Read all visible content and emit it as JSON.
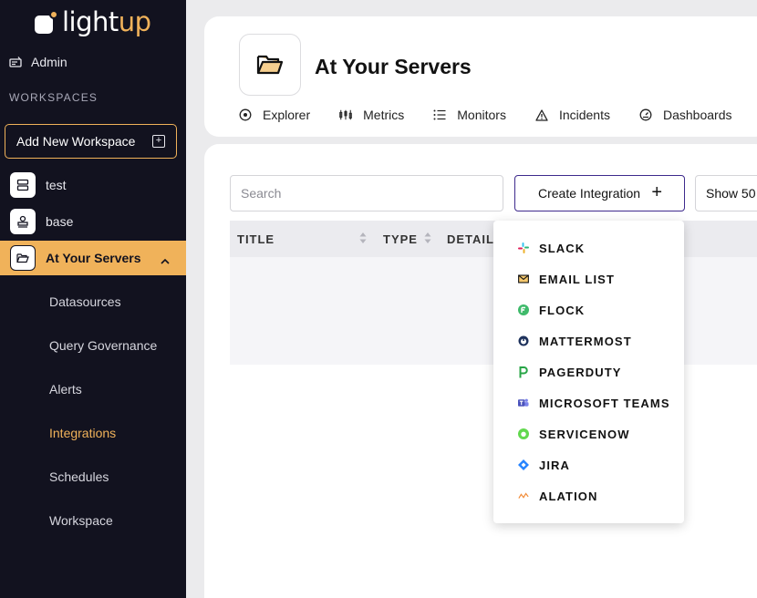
{
  "brand": {
    "part1": "light",
    "part2": "up"
  },
  "sidebar": {
    "admin_label": "Admin",
    "workspaces_label": "WORKSPACES",
    "add_workspace_label": "Add New Workspace",
    "workspaces": [
      {
        "label": "test"
      },
      {
        "label": "base"
      },
      {
        "label": "At Your Servers"
      }
    ],
    "sub_items": [
      {
        "label": "Datasources"
      },
      {
        "label": "Query Governance"
      },
      {
        "label": "Alerts"
      },
      {
        "label": "Integrations"
      },
      {
        "label": "Schedules"
      },
      {
        "label": "Workspace"
      }
    ]
  },
  "header": {
    "title": "At Your Servers",
    "tabs": [
      {
        "label": "Explorer",
        "icon": "explorer-icon"
      },
      {
        "label": "Metrics",
        "icon": "metrics-icon"
      },
      {
        "label": "Monitors",
        "icon": "monitors-icon"
      },
      {
        "label": "Incidents",
        "icon": "incidents-icon"
      },
      {
        "label": "Dashboards",
        "icon": "dashboards-icon"
      }
    ]
  },
  "toolbar": {
    "search_placeholder": "Search",
    "create_label": "Create Integration",
    "show_label": "Show 50"
  },
  "table": {
    "columns": [
      "TITLE",
      "TYPE",
      "DETAIL"
    ]
  },
  "dropdown": {
    "options": [
      {
        "label": "SLACK",
        "icon": "slack-icon"
      },
      {
        "label": "EMAIL LIST",
        "icon": "email-icon"
      },
      {
        "label": "FLOCK",
        "icon": "flock-icon"
      },
      {
        "label": "MATTERMOST",
        "icon": "mattermost-icon"
      },
      {
        "label": "PAGERDUTY",
        "icon": "pagerduty-icon"
      },
      {
        "label": "MICROSOFT TEAMS",
        "icon": "teams-icon"
      },
      {
        "label": "SERVICENOW",
        "icon": "servicenow-icon"
      },
      {
        "label": "JIRA",
        "icon": "jira-icon"
      },
      {
        "label": "ALATION",
        "icon": "alation-icon"
      }
    ]
  },
  "colors": {
    "sidebar_bg": "#12121f",
    "accent": "#f0b25a",
    "create_border": "#3e2a8c"
  }
}
